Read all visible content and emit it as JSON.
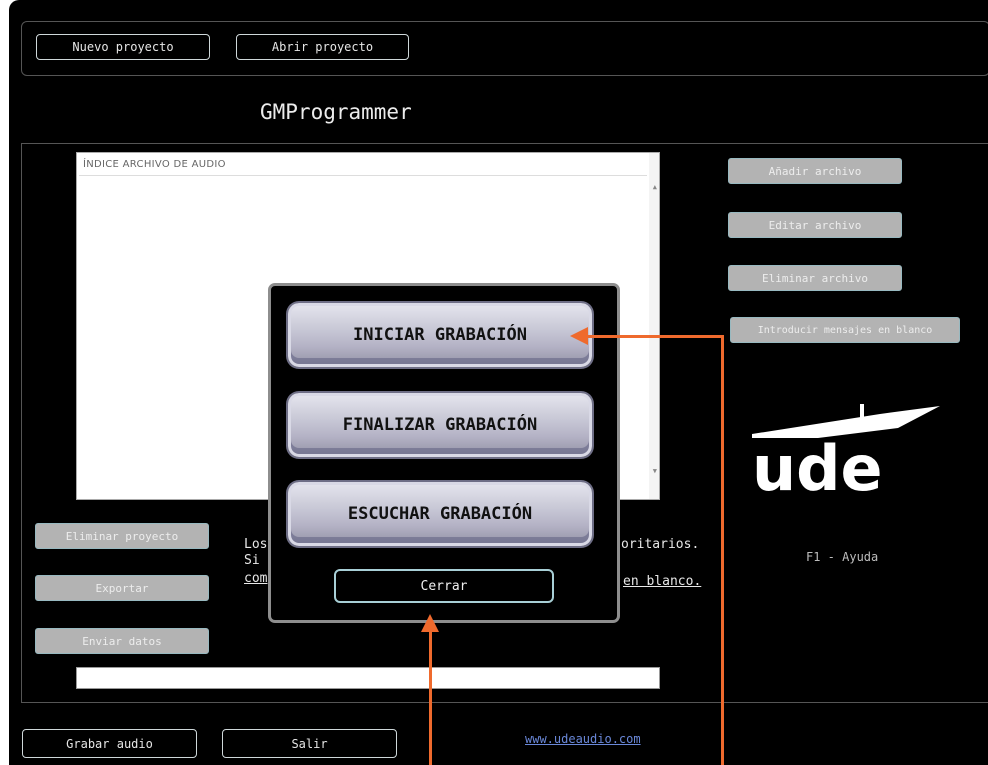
{
  "toolbar": {
    "new_project": "Nuevo proyecto",
    "open_project": "Abrir proyecto"
  },
  "app_title": "GMProgrammer",
  "list": {
    "header": "ÍNDICE  ARCHIVO DE AUDIO"
  },
  "side_buttons": {
    "add_file": "Añadir archivo",
    "edit_file": "Editar archivo",
    "delete_file": "Eliminar archivo",
    "blank_messages": "Introducir mensajes en blanco"
  },
  "left_buttons": {
    "delete_project": "Eliminar proyecto",
    "export": "Exportar",
    "send_data": "Enviar datos"
  },
  "info": {
    "line1_start": "Los",
    "line1_end": "oritarios.",
    "line2_start": "Si",
    "line3_start": "com",
    "line3_end": "en blanco."
  },
  "logo_text": "ude",
  "help": "F1 - Ayuda",
  "bottom_buttons": {
    "record_audio": "Grabar audio",
    "exit": "Salir"
  },
  "website": "www.udeaudio.com",
  "modal": {
    "start_recording": "INICIAR GRABACIÓN",
    "stop_recording": "FINALIZAR GRABACIÓN",
    "play_recording": "ESCUCHAR GRABACIÓN",
    "close": "Cerrar"
  },
  "colors": {
    "background": "#000000",
    "annotation_arrow": "#ef6a2d",
    "link": "#6a88d9"
  }
}
